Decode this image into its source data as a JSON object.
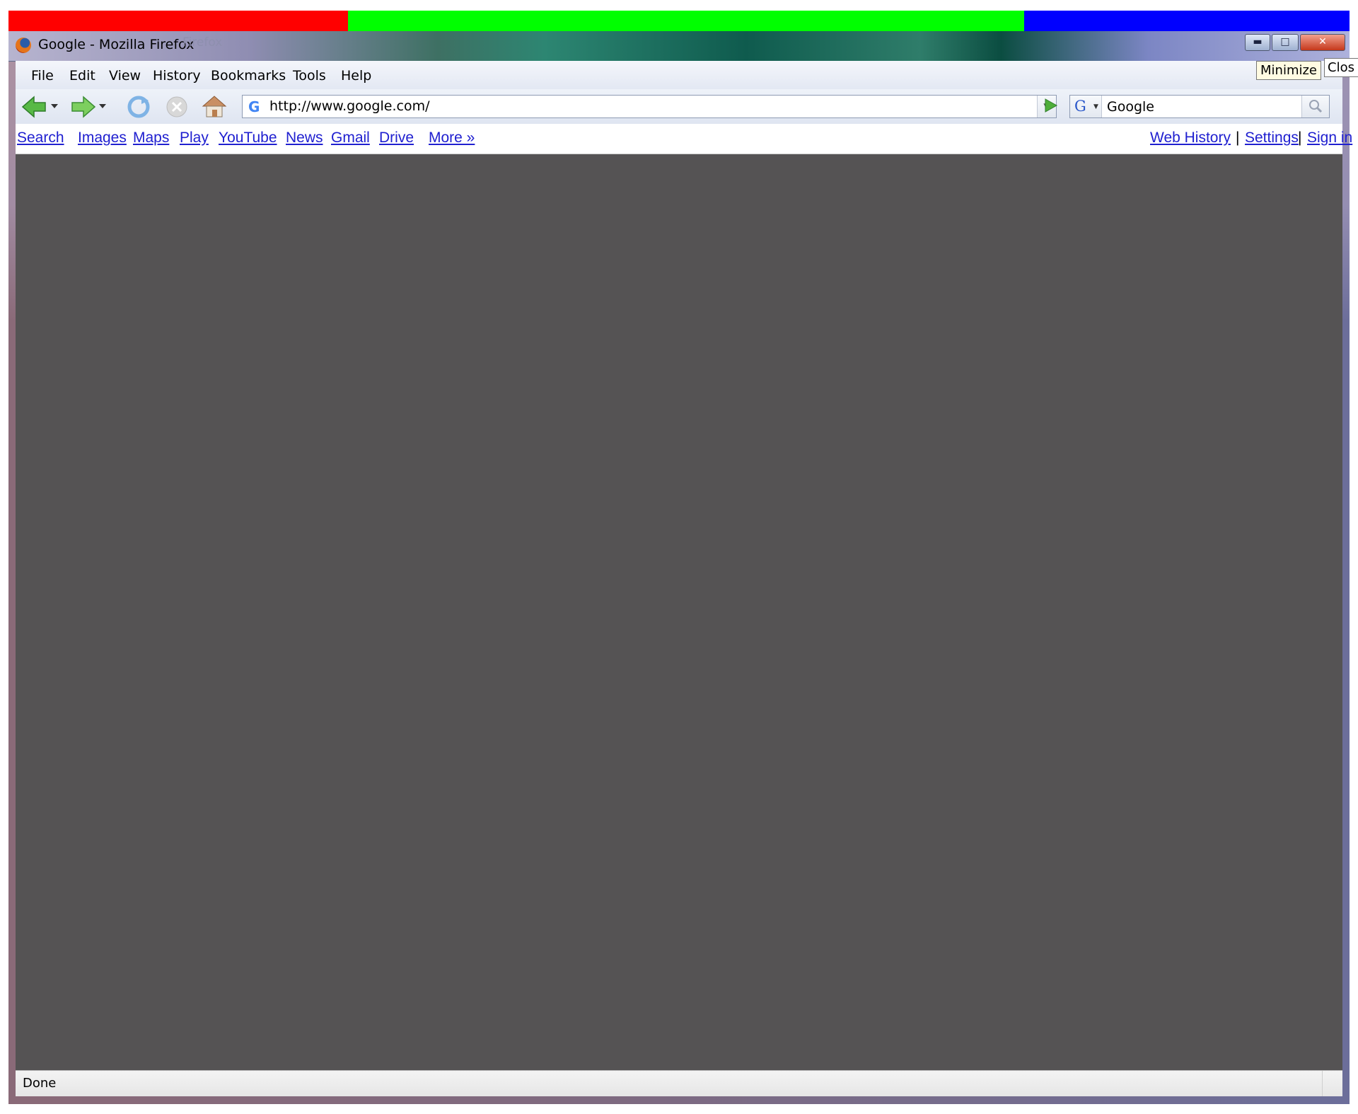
{
  "colors": {
    "strip_red": "#ff0000",
    "strip_green": "#00ff00",
    "strip_blue": "#0000ff",
    "content_bg": "#555354",
    "link": "#2020d0"
  },
  "window": {
    "title": "Google - Mozilla Firefox",
    "ghost_title": "Firefox",
    "minimize_tooltip": "Minimize",
    "close_tooltip": "Clos"
  },
  "menu": {
    "items": [
      "File",
      "Edit",
      "View",
      "History",
      "Bookmarks",
      "Tools",
      "Help"
    ]
  },
  "navbar": {
    "url": "http://www.google.com/",
    "search_engine_icon": "G",
    "search_value": "Google"
  },
  "google_bar": {
    "left_links": [
      "Search",
      "Images",
      "Maps",
      "Play",
      "YouTube",
      "News",
      "Gmail",
      "Drive",
      "More »"
    ],
    "right_links": [
      "Web History",
      "Settings",
      "Sign in"
    ],
    "separator": "|"
  },
  "status": {
    "text": "Done"
  }
}
